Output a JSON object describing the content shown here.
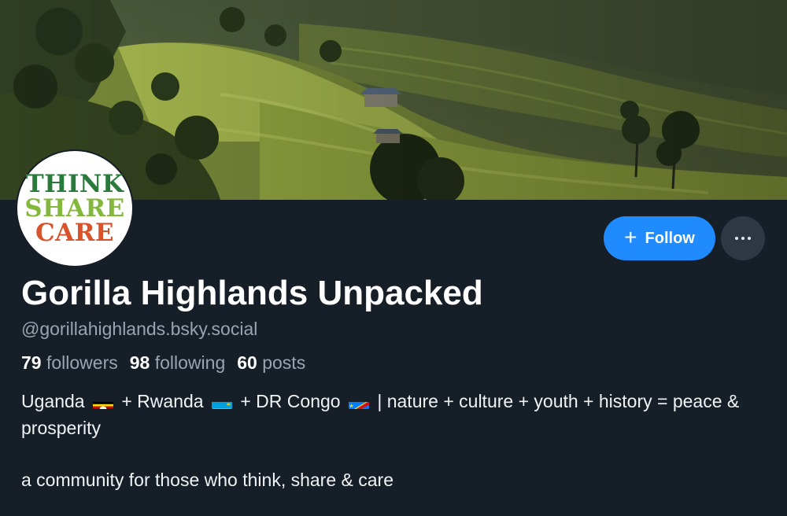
{
  "profile": {
    "display_name": "Gorilla Highlands Unpacked",
    "handle": "@gorillahighlands.bsky.social",
    "avatar_text": [
      "THINK",
      "SHARE",
      "CARE"
    ],
    "banner": "terraced green hills landscape"
  },
  "actions": {
    "follow_label": "Follow",
    "follow_icon": "plus-icon",
    "more_icon": "ellipsis-icon"
  },
  "stats": {
    "followers_count": "79",
    "followers_label": "followers",
    "following_count": "98",
    "following_label": "following",
    "posts_count": "60",
    "posts_label": "posts"
  },
  "bio": {
    "part1": "Uganda",
    "part2": "+ Rwanda",
    "part3": "+ DR Congo",
    "part4": "| nature + culture + youth + history = peace & prosperity",
    "line2": "a community for those who think, share & care",
    "flags": [
      "uganda-flag",
      "rwanda-flag",
      "dr-congo-flag"
    ]
  },
  "colors": {
    "background": "#161e27",
    "accent": "#208bfe",
    "muted_text": "#9aa4b0"
  }
}
